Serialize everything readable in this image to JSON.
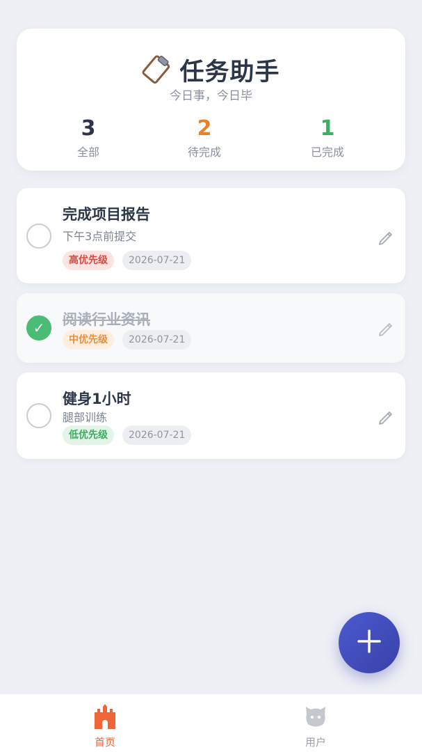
{
  "header": {
    "title": "任务助手",
    "subtitle": "今日事，今日毕",
    "stats": [
      {
        "value": "3",
        "label": "全部",
        "color": "#2d3648"
      },
      {
        "value": "2",
        "label": "待完成",
        "color": "#e8822a"
      },
      {
        "value": "1",
        "label": "已完成",
        "color": "#3bae5f"
      }
    ]
  },
  "tasks": [
    {
      "title": "完成项目报告",
      "desc": "下午3点前提交",
      "priority": "高优先级",
      "date": "2026-07-21",
      "done": false
    },
    {
      "title": "阅读行业资讯",
      "desc": "",
      "priority": "中优先级",
      "date": "2026-07-21",
      "done": true
    },
    {
      "title": "健身1小时",
      "desc": "腿部训练",
      "priority": "低优先级",
      "date": "2026-07-21",
      "done": false
    }
  ],
  "icons": {
    "header": "clipboard-icon",
    "edit": "pencil-icon",
    "fab": "plus-icon",
    "home": "castle-icon",
    "user": "user-icon"
  },
  "nav": {
    "items": [
      {
        "label": "首页",
        "active": true
      },
      {
        "label": "用户",
        "active": false
      }
    ],
    "active_color": "#f0643a",
    "inactive_color": "#9aa0a8"
  }
}
